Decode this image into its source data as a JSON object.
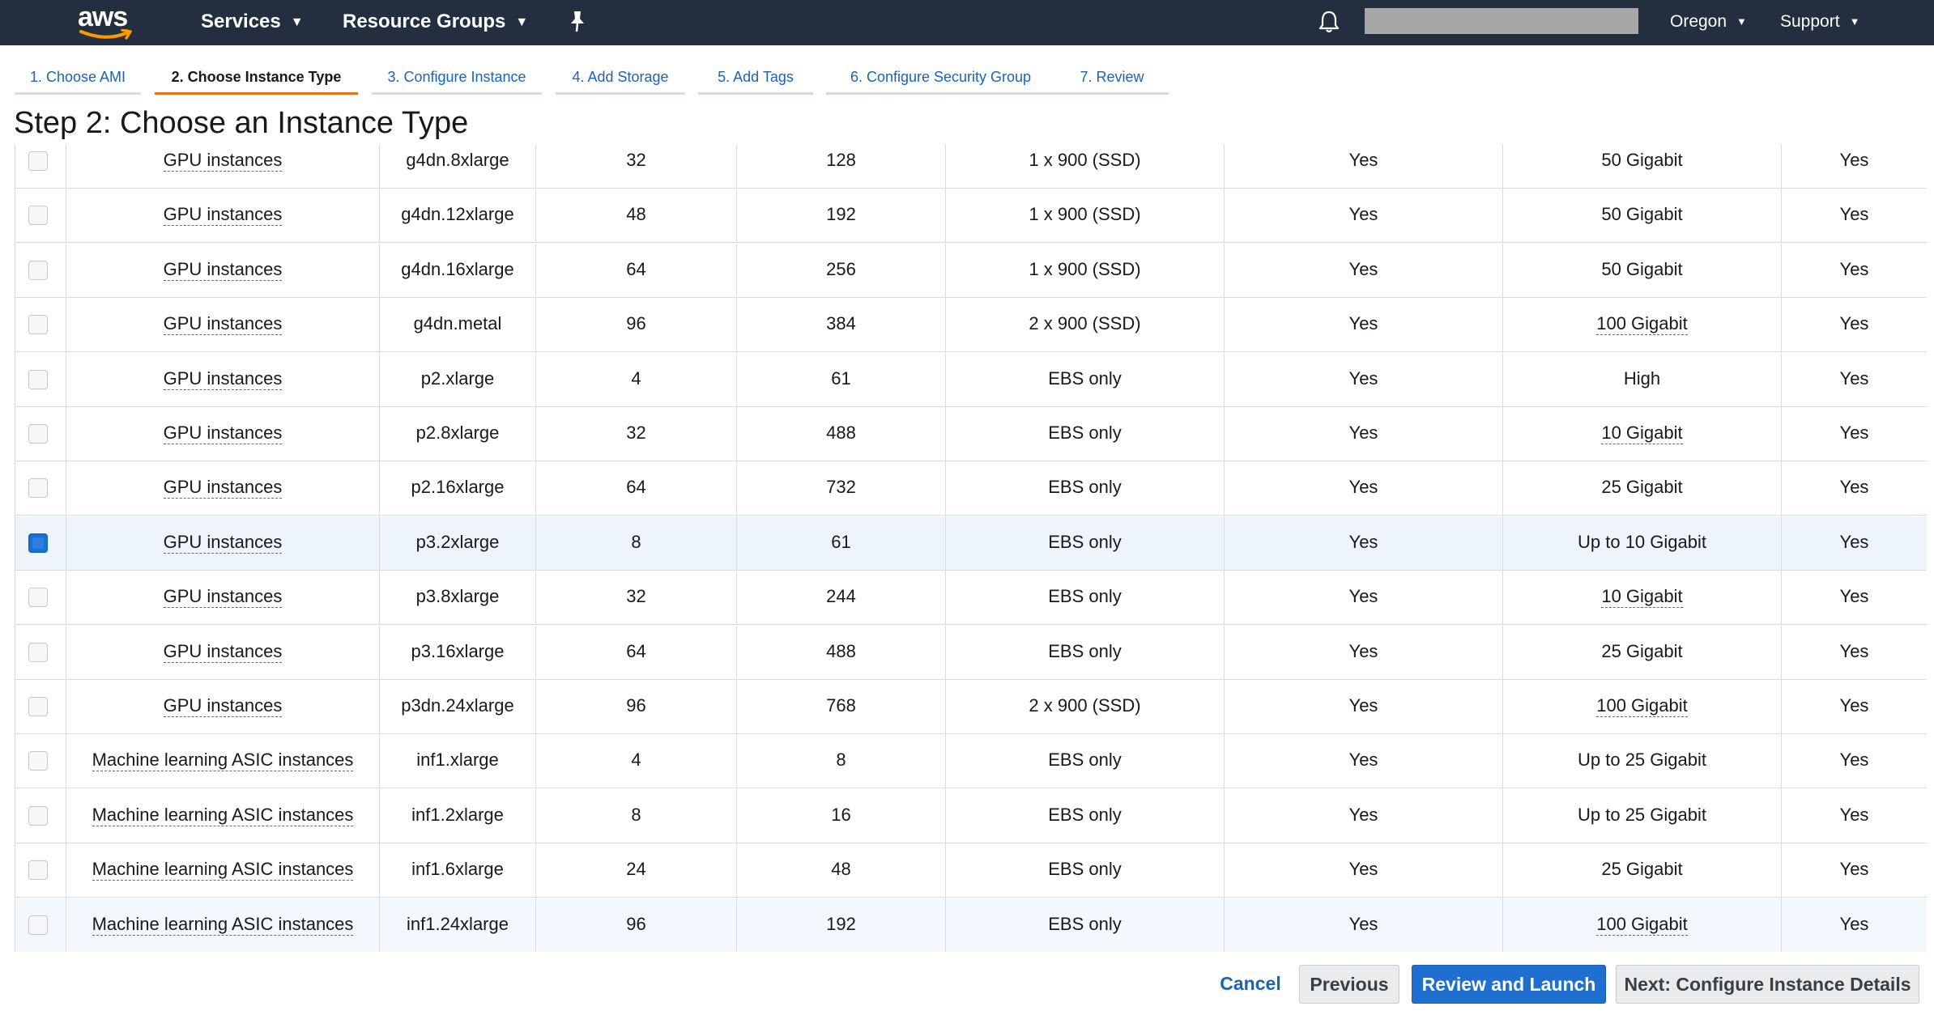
{
  "topnav": {
    "logo_text": "aws",
    "services": "Services",
    "resource_groups": "Resource Groups",
    "region": "Oregon",
    "support": "Support"
  },
  "icons": {
    "pin": "pin-icon",
    "bell": "bell-icon",
    "caret": "chevron-down-icon"
  },
  "colors": {
    "nav_bg": "#232f3e",
    "active_tab": "#ec7211",
    "link": "#1a63b6",
    "primary": "#1f6fd1",
    "selected_row": "#eef4fb"
  },
  "tabs": [
    {
      "label": "1. Choose AMI"
    },
    {
      "label": "2. Choose Instance Type"
    },
    {
      "label": "3. Configure Instance"
    },
    {
      "label": "4. Add Storage"
    },
    {
      "label": "5. Add Tags"
    },
    {
      "label": "6. Configure Security Group"
    },
    {
      "label": "7. Review"
    }
  ],
  "active_tab_index": 1,
  "page_title": "Step 2: Choose an Instance Type",
  "rows": [
    {
      "family": "GPU instances",
      "type": "g4dn.8xlarge",
      "vcpus": "32",
      "memory": "128",
      "storage": "1 x 900 (SSD)",
      "ebs": "Yes",
      "network": "50 Gigabit",
      "ipv6": "Yes",
      "checked": false
    },
    {
      "family": "GPU instances",
      "type": "g4dn.12xlarge",
      "vcpus": "48",
      "memory": "192",
      "storage": "1 x 900 (SSD)",
      "ebs": "Yes",
      "network": "50 Gigabit",
      "ipv6": "Yes",
      "checked": false
    },
    {
      "family": "GPU instances",
      "type": "g4dn.16xlarge",
      "vcpus": "64",
      "memory": "256",
      "storage": "1 x 900 (SSD)",
      "ebs": "Yes",
      "network": "50 Gigabit",
      "ipv6": "Yes",
      "checked": false
    },
    {
      "family": "GPU instances",
      "type": "g4dn.metal",
      "vcpus": "96",
      "memory": "384",
      "storage": "2 x 900 (SSD)",
      "ebs": "Yes",
      "network": "100 Gigabit",
      "ipv6": "Yes",
      "checked": false
    },
    {
      "family": "GPU instances",
      "type": "p2.xlarge",
      "vcpus": "4",
      "memory": "61",
      "storage": "EBS only",
      "ebs": "Yes",
      "network": "High",
      "ipv6": "Yes",
      "checked": false
    },
    {
      "family": "GPU instances",
      "type": "p2.8xlarge",
      "vcpus": "32",
      "memory": "488",
      "storage": "EBS only",
      "ebs": "Yes",
      "network": "10 Gigabit",
      "ipv6": "Yes",
      "checked": false
    },
    {
      "family": "GPU instances",
      "type": "p2.16xlarge",
      "vcpus": "64",
      "memory": "732",
      "storage": "EBS only",
      "ebs": "Yes",
      "network": "25 Gigabit",
      "ipv6": "Yes",
      "checked": false
    },
    {
      "family": "GPU instances",
      "type": "p3.2xlarge",
      "vcpus": "8",
      "memory": "61",
      "storage": "EBS only",
      "ebs": "Yes",
      "network": "Up to 10 Gigabit",
      "ipv6": "Yes",
      "checked": true
    },
    {
      "family": "GPU instances",
      "type": "p3.8xlarge",
      "vcpus": "32",
      "memory": "244",
      "storage": "EBS only",
      "ebs": "Yes",
      "network": "10 Gigabit",
      "ipv6": "Yes",
      "checked": false
    },
    {
      "family": "GPU instances",
      "type": "p3.16xlarge",
      "vcpus": "64",
      "memory": "488",
      "storage": "EBS only",
      "ebs": "Yes",
      "network": "25 Gigabit",
      "ipv6": "Yes",
      "checked": false
    },
    {
      "family": "GPU instances",
      "type": "p3dn.24xlarge",
      "vcpus": "96",
      "memory": "768",
      "storage": "2 x 900 (SSD)",
      "ebs": "Yes",
      "network": "100 Gigabit",
      "ipv6": "Yes",
      "checked": false
    },
    {
      "family": "Machine learning ASIC instances",
      "type": "inf1.xlarge",
      "vcpus": "4",
      "memory": "8",
      "storage": "EBS only",
      "ebs": "Yes",
      "network": "Up to 25 Gigabit",
      "ipv6": "Yes",
      "checked": false
    },
    {
      "family": "Machine learning ASIC instances",
      "type": "inf1.2xlarge",
      "vcpus": "8",
      "memory": "16",
      "storage": "EBS only",
      "ebs": "Yes",
      "network": "Up to 25 Gigabit",
      "ipv6": "Yes",
      "checked": false
    },
    {
      "family": "Machine learning ASIC instances",
      "type": "inf1.6xlarge",
      "vcpus": "24",
      "memory": "48",
      "storage": "EBS only",
      "ebs": "Yes",
      "network": "25 Gigabit",
      "ipv6": "Yes",
      "checked": false
    },
    {
      "family": "Machine learning ASIC instances",
      "type": "inf1.24xlarge",
      "vcpus": "96",
      "memory": "192",
      "storage": "EBS only",
      "ebs": "Yes",
      "network": "100 Gigabit",
      "ipv6": "Yes",
      "checked": false
    }
  ],
  "selected_row_index": 7,
  "hover_row_index": 14,
  "footer": {
    "cancel": "Cancel",
    "previous": "Previous",
    "review_launch": "Review and Launch",
    "next": "Next: Configure Instance Details"
  }
}
